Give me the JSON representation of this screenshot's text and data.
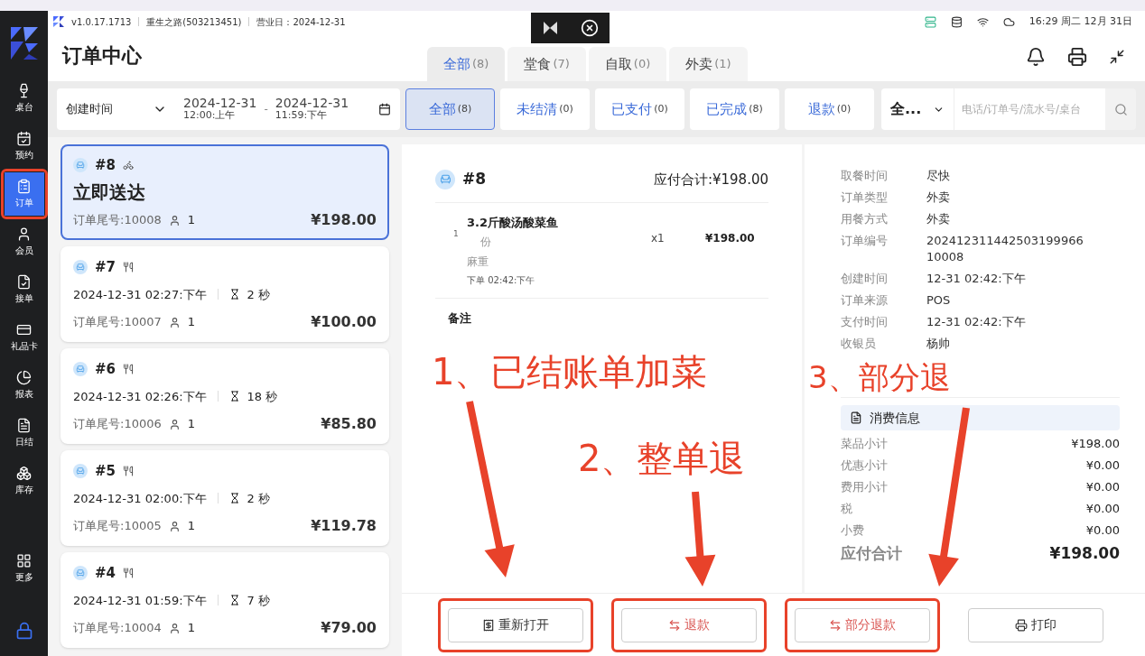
{
  "header": {
    "version": "v1.0.17.1713",
    "store": "重生之路(503213451)",
    "business_date": "营业日：2024-12-31",
    "clock": "16:29 周二 12月 31日"
  },
  "title": "订单中心",
  "tabs": [
    {
      "label": "全部",
      "count": "(8)",
      "selected": true
    },
    {
      "label": "堂食",
      "count": "(7)",
      "selected": false
    },
    {
      "label": "自取",
      "count": "(0)",
      "selected": false
    },
    {
      "label": "外卖",
      "count": "(1)",
      "selected": false
    }
  ],
  "date_filter": {
    "field": "创建时间",
    "start_date": "2024-12-31",
    "start_time": "12:00:上午",
    "separator": "-",
    "end_date": "2024-12-31",
    "end_time": "11:59:下午"
  },
  "status_filters": [
    {
      "label": "全部",
      "count": "(8)",
      "selected": true
    },
    {
      "label": "未结清",
      "count": "(0)",
      "selected": false
    },
    {
      "label": "已支付",
      "count": "(0)",
      "selected": false
    },
    {
      "label": "已完成",
      "count": "(8)",
      "selected": false
    },
    {
      "label": "退款",
      "count": "(0)",
      "selected": false
    }
  ],
  "search": {
    "scope": "全...",
    "placeholder": "电话/订单号/流水号/桌台"
  },
  "sidebar": {
    "items": [
      {
        "label": "桌台",
        "selected": false,
        "highlighted": false
      },
      {
        "label": "预约",
        "selected": false,
        "highlighted": false
      },
      {
        "label": "订单",
        "selected": true,
        "highlighted": true
      },
      {
        "label": "会员",
        "selected": false,
        "highlighted": false
      },
      {
        "label": "接单",
        "selected": false,
        "highlighted": false
      },
      {
        "label": "礼品卡",
        "selected": false,
        "highlighted": false
      },
      {
        "label": "报表",
        "selected": false,
        "highlighted": false
      },
      {
        "label": "日结",
        "selected": false,
        "highlighted": false
      },
      {
        "label": "库存",
        "selected": false,
        "highlighted": false
      }
    ],
    "more": {
      "label": "更多",
      "selected": false,
      "highlighted": false
    }
  },
  "orders": [
    {
      "number": "#8",
      "kind": "delivery",
      "headline": "立即送达",
      "tail_no": "订单尾号:10008",
      "guests": "1",
      "amount": "¥198.00",
      "selected": true
    },
    {
      "number": "#7",
      "kind": "dine_in",
      "time": "2024-12-31 02:27:下午",
      "wait": "2 秒",
      "tail_no": "订单尾号:10007",
      "guests": "1",
      "amount": "¥100.00",
      "selected": false
    },
    {
      "number": "#6",
      "kind": "dine_in",
      "time": "2024-12-31 02:26:下午",
      "wait": "18 秒",
      "tail_no": "订单尾号:10006",
      "guests": "1",
      "amount": "¥85.80",
      "selected": false
    },
    {
      "number": "#5",
      "kind": "dine_in",
      "time": "2024-12-31 02:00:下午",
      "wait": "2 秒",
      "tail_no": "订单尾号:10005",
      "guests": "1",
      "amount": "¥119.78",
      "selected": false
    },
    {
      "number": "#4",
      "kind": "dine_in",
      "time": "2024-12-31 01:59:下午",
      "wait": "7 秒",
      "tail_no": "订单尾号:10004",
      "guests": "1",
      "amount": "¥79.00",
      "selected": false
    }
  ],
  "detail": {
    "number": "#8",
    "total_due": "应付合计:¥198.00",
    "items": [
      {
        "index": "1",
        "name": "3.2斤酸汤酸菜鱼",
        "unit": "份",
        "note": "麻重",
        "order_time": "下单 02:42:下午",
        "qty": "x1",
        "price": "¥198.00"
      }
    ],
    "remark_label": "备注"
  },
  "info": [
    {
      "label": "取餐时间",
      "value": "尽快"
    },
    {
      "label": "订单类型",
      "value": "外卖"
    },
    {
      "label": "用餐方式",
      "value": "外卖"
    },
    {
      "label": "订单编号",
      "value": "202412311442503199966 10008"
    },
    {
      "label": "创建时间",
      "value": "12-31 02:42:下午"
    },
    {
      "label": "订单来源",
      "value": "POS"
    },
    {
      "label": "支付时间",
      "value": "12-31 02:42:下午"
    },
    {
      "label": "收银员",
      "value": "杨帅"
    }
  ],
  "consumption": {
    "title": "消费信息",
    "rows": [
      {
        "label": "菜品小计",
        "value": "¥198.00"
      },
      {
        "label": "优惠小计",
        "value": "¥0.00"
      },
      {
        "label": "费用小计",
        "value": "¥0.00"
      },
      {
        "label": "税",
        "value": "¥0.00"
      },
      {
        "label": "小费",
        "value": "¥0.00"
      }
    ],
    "total": {
      "label": "应付合计",
      "value": "¥198.00"
    }
  },
  "actions": [
    {
      "label": "重新打开",
      "kind": "reopen",
      "highlighted": true
    },
    {
      "label": "退款",
      "kind": "refund",
      "highlighted": true
    },
    {
      "label": "部分退款",
      "kind": "refund",
      "highlighted": true
    },
    {
      "label": "打印",
      "kind": "print",
      "highlighted": false
    }
  ],
  "annotations": [
    {
      "text": "1、已结账单加菜"
    },
    {
      "text": "2、整单退"
    },
    {
      "text": "3、部分退"
    }
  ]
}
